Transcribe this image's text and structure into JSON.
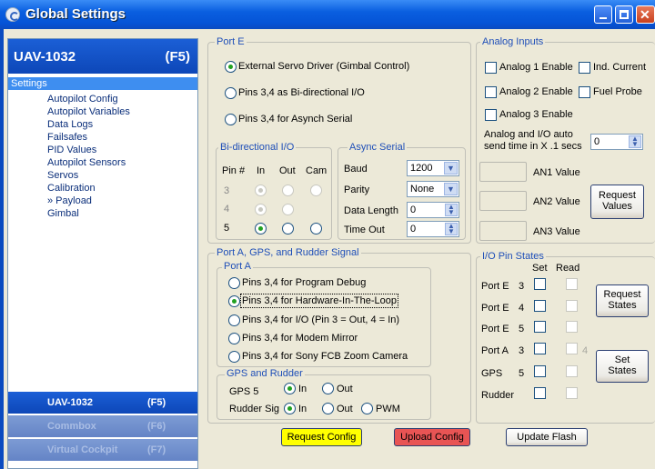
{
  "title": "Global Settings",
  "sidebar": {
    "header_name": "UAV-1032",
    "header_key": "(F5)",
    "selected": "Settings",
    "items": [
      "Autopilot Config",
      "Autopilot Variables",
      "Data Logs",
      "Failsafes",
      "PID Values",
      "Autopilot Sensors",
      "Servos",
      "Calibration",
      "» Payload",
      "Gimbal"
    ],
    "bars": [
      {
        "name": "UAV-1032",
        "key": "(F5)"
      },
      {
        "name": "Commbox",
        "key": "(F6)"
      },
      {
        "name": "Virtual Cockpit",
        "key": "(F7)"
      }
    ]
  },
  "porte": {
    "title": "Port E",
    "options": [
      "External Servo Driver (Gimbal Control)",
      "Pins 3,4 as Bi-directional I/O",
      "Pins 3,4 for Asynch Serial"
    ],
    "bidir": {
      "title": "Bi-directional I/O",
      "h_pin": "Pin #",
      "h_in": "In",
      "h_out": "Out",
      "h_cam": "Cam",
      "pins": [
        "3",
        "4",
        "5"
      ]
    },
    "async": {
      "title": "Async Serial",
      "baud_label": "Baud",
      "baud": "1200",
      "parity_label": "Parity",
      "parity": "None",
      "dl_label": "Data Length",
      "dl": "0",
      "to_label": "Time Out",
      "to": "0"
    }
  },
  "porta": {
    "title": "Port A, GPS, and Rudder Signal",
    "sub": "Port A",
    "options": [
      "Pins 3,4 for Program Debug",
      "Pins 3,4 for Hardware-In-The-Loop",
      "Pins 3,4 for I/O (Pin 3 = Out, 4 = In)",
      "Pins 3,4 for Modem Mirror",
      "Pins 3,4 for Sony FCB Zoom Camera"
    ],
    "gps": {
      "title": "GPS and Rudder",
      "gps_label": "GPS 5",
      "in": "In",
      "out": "Out",
      "rud_label": "Rudder Sig",
      "pwm": "PWM"
    }
  },
  "analog": {
    "title": "Analog Inputs",
    "a1": "Analog 1 Enable",
    "a2": "Analog 2 Enable",
    "a3": "Analog 3 Enable",
    "ind": "Ind. Current",
    "fuel": "Fuel Probe",
    "auto_label1": "Analog and I/O auto",
    "auto_label2": "send time in X .1 secs",
    "auto_val": "0",
    "an1": "AN1 Value",
    "an2": "AN2 Value",
    "an3": "AN3 Value",
    "req1": "Request",
    "req2": "Values"
  },
  "io": {
    "title": "I/O Pin States",
    "set": "Set",
    "read": "Read",
    "rows": [
      {
        "port": "Port E",
        "pin": "3"
      },
      {
        "port": "Port E",
        "pin": "4"
      },
      {
        "port": "Port E",
        "pin": "5"
      },
      {
        "port": "Port A",
        "pin": "3"
      },
      {
        "port": "GPS",
        "pin": "5"
      },
      {
        "port": "Rudder",
        "pin": ""
      }
    ],
    "extra": "4",
    "req1": "Request",
    "req2": "States",
    "set1": "Set",
    "set2": "States"
  },
  "footer": {
    "request": "Request Config",
    "upload": "Upload Config",
    "update": "Update Flash"
  },
  "colors": {
    "accent": "#0a5fe0",
    "request": "#ffff00",
    "upload": "#e85454"
  }
}
